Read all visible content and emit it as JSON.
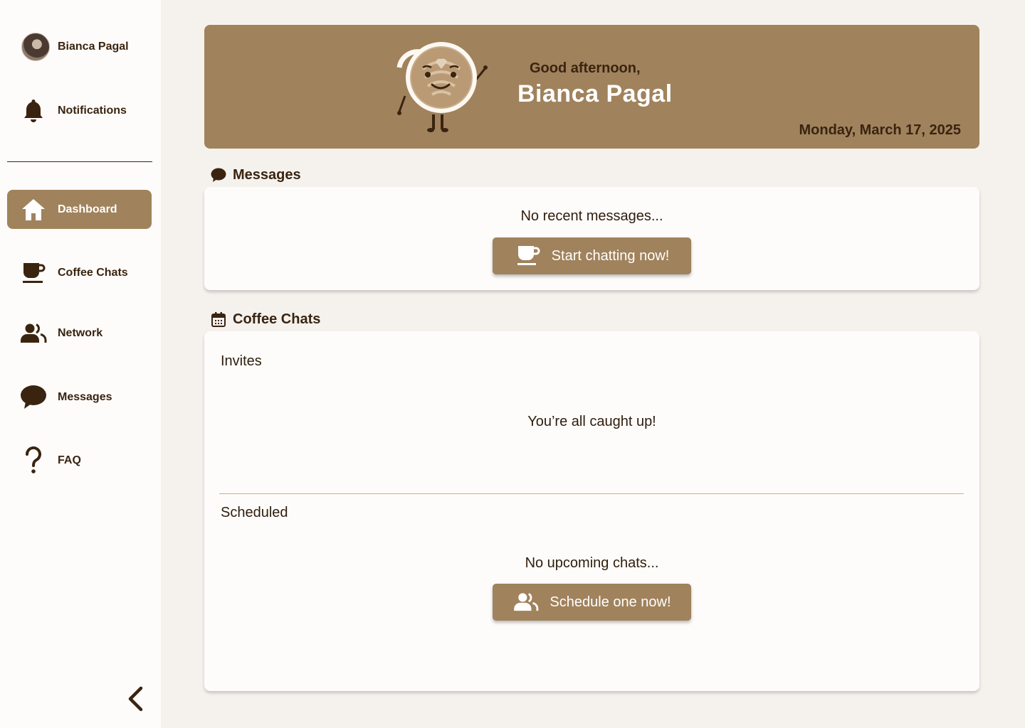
{
  "colors": {
    "accent": "#a0825c",
    "text": "#3a2410",
    "background": "#f5f2ee",
    "card": "#fefcfb"
  },
  "sidebar": {
    "profile": {
      "name": "Bianca Pagal",
      "icon": "avatar"
    },
    "notifications": {
      "label": "Notifications",
      "icon": "bell-icon"
    },
    "items": [
      {
        "label": "Dashboard",
        "icon": "home-icon",
        "active": true
      },
      {
        "label": "Coffee Chats",
        "icon": "coffee-cup-icon",
        "active": false
      },
      {
        "label": "Network",
        "icon": "people-icon",
        "active": false
      },
      {
        "label": "Messages",
        "icon": "chat-bubble-icon",
        "active": false
      },
      {
        "label": "FAQ",
        "icon": "question-mark-icon",
        "active": false
      }
    ],
    "collapse_icon": "chevron-left-icon"
  },
  "banner": {
    "greeting": "Good afternoon,",
    "name": "Bianca Pagal",
    "date": "Monday, March 17, 2025",
    "mascot_icon": "latte-mascot-icon"
  },
  "messages": {
    "title": "Messages",
    "icon": "chat-bubble-icon",
    "empty_text": "No recent messages...",
    "button_label": "Start chatting now!",
    "button_icon": "coffee-cup-icon"
  },
  "coffee_chats": {
    "title": "Coffee Chats",
    "icon": "calendar-icon",
    "invites": {
      "label": "Invites",
      "empty_text": "You’re all caught up!"
    },
    "scheduled": {
      "label": "Scheduled",
      "empty_text": "No upcoming chats...",
      "button_label": "Schedule one now!",
      "button_icon": "people-icon"
    }
  }
}
